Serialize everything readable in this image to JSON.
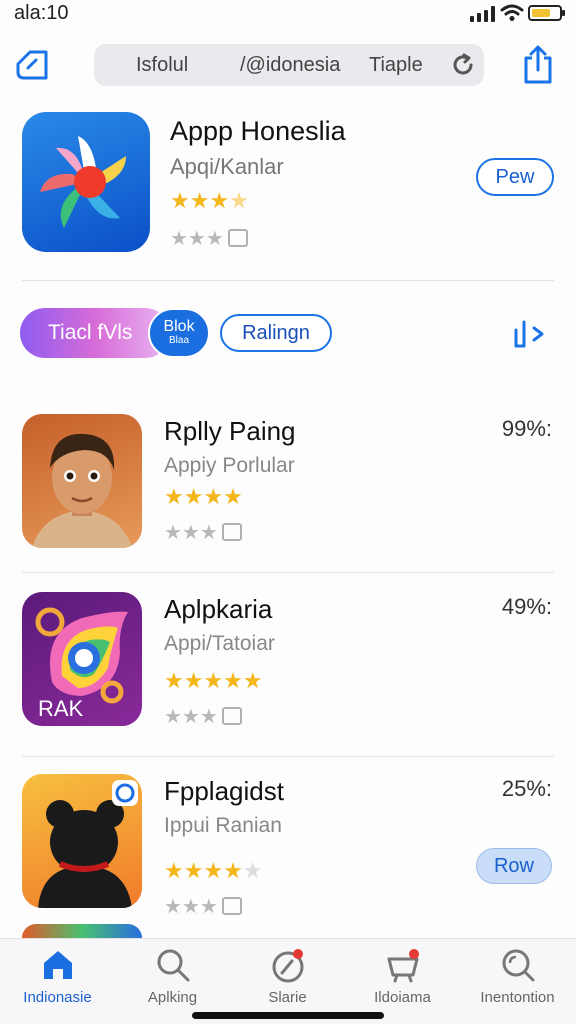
{
  "status": {
    "time": "ala:10",
    "battery_level": 0.7
  },
  "topbar": {
    "segments": [
      "Isfolul",
      "/@idonesia",
      "Tiaple"
    ]
  },
  "featured": {
    "title": "Appp Honeslia",
    "subtitle": "Apqi/Kanlar",
    "rating": 3.5,
    "button": "Pew"
  },
  "chips": {
    "chip1": "Tiacl fVls",
    "chip2_top": "Blok",
    "chip2_bottom": "Blaa",
    "chip3": "Ralingn"
  },
  "apps": [
    {
      "title": "Rplly Paing",
      "subtitle": "Appiy Porlular",
      "percent": "99%:",
      "rating": 4,
      "button": ""
    },
    {
      "title": "Aplpkaria",
      "subtitle": "Appi/Tatoiar",
      "percent": "49%:",
      "rating": 5,
      "icon_text": "RAK",
      "button": ""
    },
    {
      "title": "Fpplagidst",
      "subtitle": "Ippui Ranian",
      "percent": "25%:",
      "rating": 4,
      "button": "Row"
    }
  ],
  "tabs": [
    {
      "label": "Indionasie",
      "icon": "home-icon",
      "active": true
    },
    {
      "label": "Aplking",
      "icon": "search-icon",
      "active": false
    },
    {
      "label": "Slarie",
      "icon": "compass-icon",
      "active": false
    },
    {
      "label": "Ildoiama",
      "icon": "basket-icon",
      "active": false
    },
    {
      "label": "Inentontion",
      "icon": "magnifier-icon",
      "active": false
    }
  ],
  "colors": {
    "accent": "#1a73e8",
    "star": "#f3b61b"
  }
}
